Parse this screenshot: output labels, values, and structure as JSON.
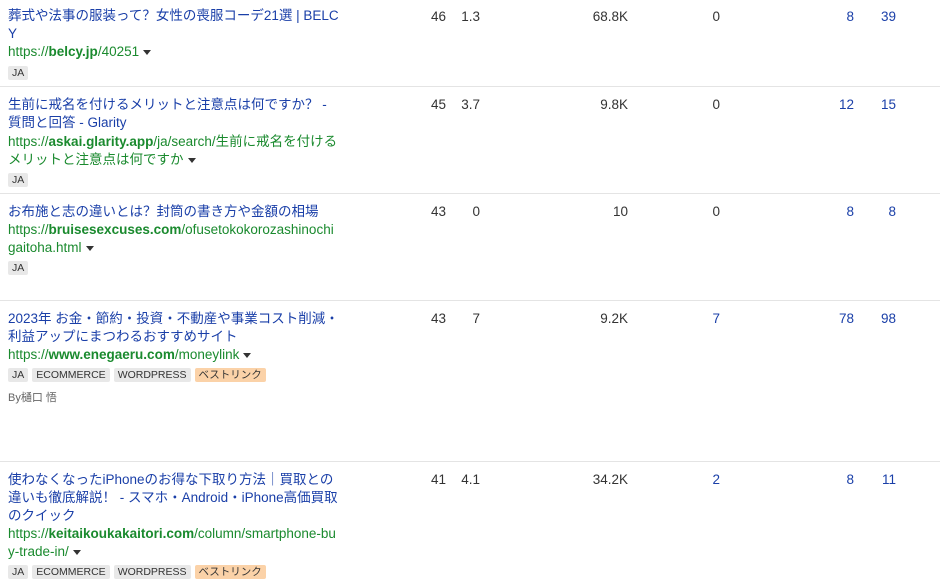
{
  "rows": [
    {
      "title": "葬式や法事の服装って？女性の喪服コーデ21選 | BELCY",
      "url_prefix": "https://",
      "url_domain": "belcy.jp",
      "url_path": "/40251",
      "tags": [
        "JA"
      ],
      "dr": "46",
      "ur": "1.3",
      "traffic": "68.8K",
      "keywords": "0",
      "ref_domains": "8",
      "backlinks": "39"
    },
    {
      "title": "生前に戒名を付けるメリットと注意点は何ですか？ - 質問と回答 - Glarity",
      "url_prefix": "https://",
      "url_domain": "askai.glarity.app",
      "url_path": "/ja/search/生前に戒名を付けるメリットと注意点は何ですか",
      "tags": [
        "JA"
      ],
      "dr": "45",
      "ur": "3.7",
      "traffic": "9.8K",
      "keywords": "0",
      "ref_domains": "12",
      "backlinks": "15"
    },
    {
      "title": "お布施と志の違いとは？封筒の書き方や金額の相場",
      "url_prefix": "https://",
      "url_domain": "bruisesexcuses.com",
      "url_path": "/ofusetokokorozashinochigaitoha.html",
      "tags": [
        "JA"
      ],
      "dr": "43",
      "ur": "0",
      "traffic": "10",
      "keywords": "0",
      "ref_domains": "8",
      "backlinks": "8"
    },
    {
      "title": "2023年 お金・節約・投資・不動産や事業コスト削減・利益アップにまつわるおすすめサイト",
      "url_prefix": "https://",
      "url_domain": "www.enegaeru.com",
      "url_path": "/moneylink",
      "tags": [
        "JA",
        "ECOMMERCE",
        "WORDPRESS",
        "ベストリンク"
      ],
      "author": "By樋口 悟",
      "dr": "43",
      "ur": "7",
      "traffic": "9.2K",
      "keywords": "7",
      "ref_domains": "78",
      "backlinks": "98"
    },
    {
      "title": "使わなくなったiPhoneのお得な下取り方法｜買取との違いも徹底解説！ - スマホ・Android・iPhone高価買取のクイック",
      "url_prefix": "https://",
      "url_domain": "keitaikoukakaitori.com",
      "url_path": "/column/smartphone-buy-trade-in/",
      "tags": [
        "JA",
        "ECOMMERCE",
        "WORDPRESS",
        "ベストリンク"
      ],
      "dr": "41",
      "ur": "4.1",
      "traffic": "34.2K",
      "keywords": "2",
      "ref_domains": "8",
      "backlinks": "11"
    }
  ]
}
